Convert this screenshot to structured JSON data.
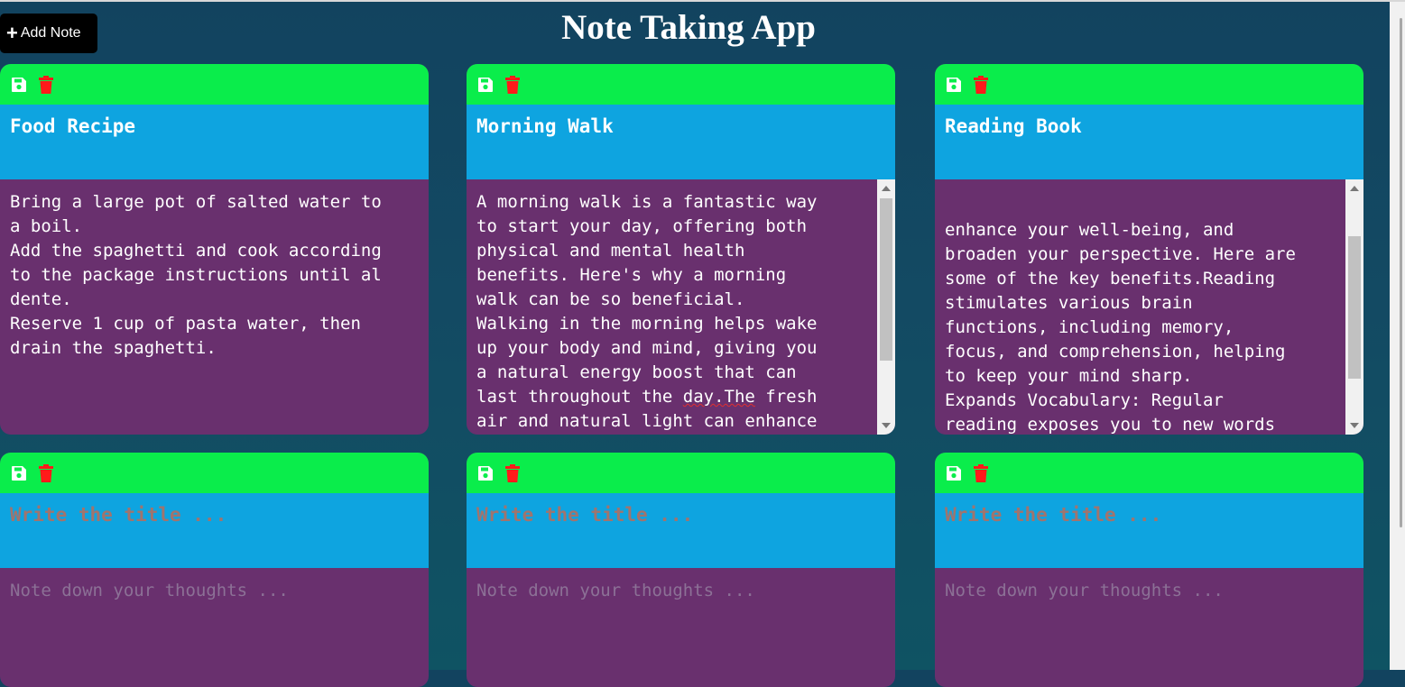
{
  "app": {
    "title": "Note Taking App",
    "add_note_label": "Add Note"
  },
  "placeholders": {
    "title": "Write the title ...",
    "body": "Note down your thoughts ..."
  },
  "notes": [
    {
      "title": "Food Recipe",
      "body": "Bring a large pot of salted water to\na boil.\nAdd the spaghetti and cook according\nto the package instructions until al\ndente.\nReserve 1 cup of pasta water, then\ndrain the spaghetti."
    },
    {
      "title": "Morning Walk",
      "body_pre": "A morning walk is a fantastic way\nto start your day, offering both\nphysical and mental health\nbenefits. Here's why a morning\nwalk can be so beneficial.\nWalking in the morning helps wake\nup your body and mind, giving you\na natural energy boost that can\nlast throughout the ",
      "body_flagged": "day.The",
      "body_post": " fresh\nair and natural light can enhance"
    },
    {
      "title": "Reading Book",
      "body": "enhance your well-being, and\nbroaden your perspective. Here are\nsome of the key benefits.Reading\nstimulates various brain\nfunctions, including memory,\nfocus, and comprehension, helping\nto keep your mind sharp.\nExpands Vocabulary: Regular\nreading exposes you to new words\nand phrases, improving your\nlanguage skills and communication"
    }
  ],
  "icons": {
    "save": "floppy-disk-icon",
    "delete": "trash-icon"
  },
  "colors": {
    "toolbar": "#0aed4b",
    "title_bar": "#0ea4e0",
    "body": "#69306e",
    "delete_icon": "#ff1a1a",
    "background": "#12435f"
  }
}
